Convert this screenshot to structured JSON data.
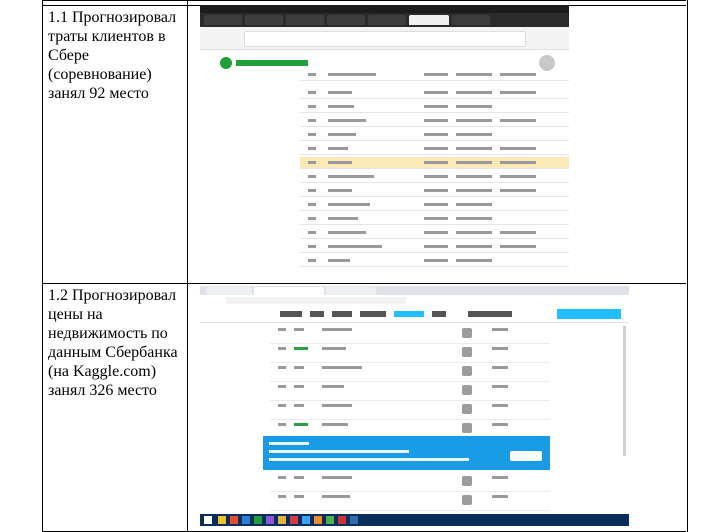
{
  "rows": [
    {
      "description": "1.1 Прогнозировал траты клиентов в Сбере (соревнование) занял 92 место"
    },
    {
      "description": "1.2 Прогнозировал цены на недвижимость по данным Сбербанка (на Kaggle.com) занял 326 место"
    }
  ],
  "colors": {
    "sber_green": "#21a038",
    "kaggle_blue": "#20beff",
    "highlight_row": "#fbe9b7",
    "best_entry_banner": "#1a9be6",
    "taskbar": "#0a2d5c"
  }
}
